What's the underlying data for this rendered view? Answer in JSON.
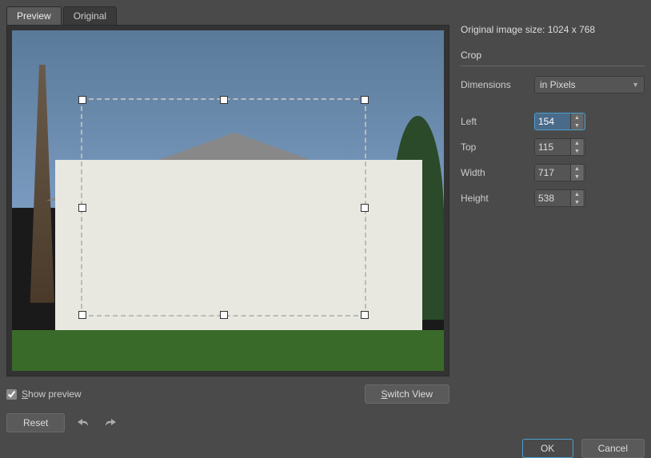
{
  "tabs": {
    "preview": "Preview",
    "original": "Original"
  },
  "info": {
    "original_size_label": "Original image size: 1024 x 768"
  },
  "crop": {
    "title": "Crop",
    "dimensions_label": "Dimensions",
    "dimensions_value": "in Pixels",
    "fields": {
      "left": {
        "label": "Left",
        "value": "154"
      },
      "top": {
        "label": "Top",
        "value": "115"
      },
      "width": {
        "label": "Width",
        "value": "717"
      },
      "height": {
        "label": "Height",
        "value": "538"
      }
    }
  },
  "preview": {
    "show_preview_label": "Show preview",
    "show_preview_checked": true,
    "switch_view": "Switch View"
  },
  "footer": {
    "reset": "Reset",
    "ok": "OK",
    "cancel": "Cancel"
  }
}
